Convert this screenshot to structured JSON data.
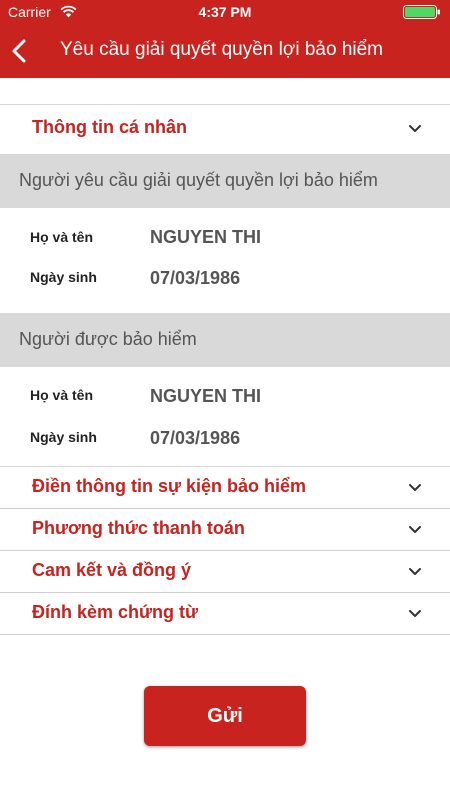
{
  "status_bar": {
    "carrier": "Carrier",
    "time": "4:37 PM"
  },
  "nav": {
    "title": "Yêu cầu giải quyết quyền lợi bảo hiểm"
  },
  "sections": {
    "personal_info": "Thông tin cá nhân",
    "event_info": "Điền thông tin sự kiện bảo hiểm",
    "payment_method": "Phương thức thanh toán",
    "commitment": "Cam kết và đồng ý",
    "attachments": "Đính kèm chứng từ"
  },
  "requester": {
    "header": "Người yêu cầu giải quyết quyền lợi bảo hiểm",
    "name_label": "Họ và tên",
    "name_value": "NGUYEN THI",
    "dob_label": "Ngày sinh",
    "dob_value": "07/03/1986"
  },
  "insured": {
    "header": "Người được bảo hiểm",
    "name_label": "Họ và tên",
    "name_value": "NGUYEN THI",
    "dob_label": "Ngày sinh",
    "dob_value": "07/03/1986"
  },
  "submit_label": "Gửi",
  "colors": {
    "brand_red": "#c8231f",
    "group_header_bg": "#d9d9d9"
  }
}
